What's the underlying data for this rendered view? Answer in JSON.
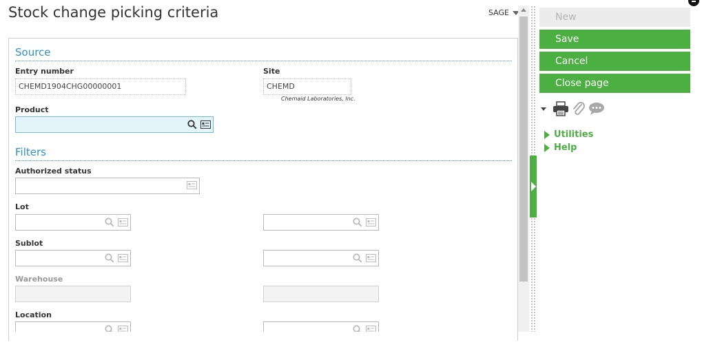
{
  "page": {
    "title": "Stock change picking criteria",
    "user_menu": "SAGE"
  },
  "source": {
    "heading": "Source",
    "entry_number_label": "Entry number",
    "entry_number_value": "CHEMD1904CHG00000001",
    "site_label": "Site",
    "site_value": "CHEMD",
    "site_description": "Chemaid Laboratories, Inc.",
    "product_label": "Product",
    "product_value": ""
  },
  "filters": {
    "heading": "Filters",
    "authorized_status_label": "Authorized status",
    "lot_label": "Lot",
    "sublot_label": "Sublot",
    "warehouse_label": "Warehouse",
    "location_label": "Location"
  },
  "actions": {
    "new": "New",
    "save": "Save",
    "cancel": "Cancel",
    "close_page": "Close page"
  },
  "side_links": {
    "utilities": "Utilities",
    "help": "Help"
  },
  "colors": {
    "accent_green": "#4caf42",
    "section_blue": "#2e93c8",
    "focus_field": "#e3f5fb"
  },
  "icons": [
    "search-icon",
    "list-icon",
    "print-icon",
    "paperclip-icon",
    "comment-icon",
    "chevron-down-icon"
  ]
}
